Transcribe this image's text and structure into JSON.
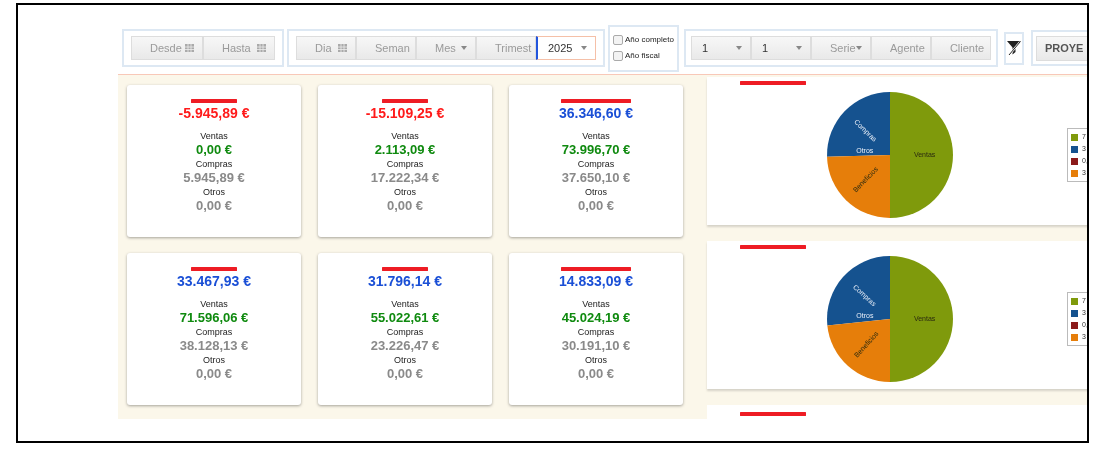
{
  "toolbar": {
    "date_range": [
      {
        "placeholder": "Desde",
        "kind": "date"
      },
      {
        "placeholder": "Hasta",
        "kind": "date"
      }
    ],
    "period": [
      {
        "placeholder": "Dia",
        "kind": "date",
        "focused": false
      },
      {
        "placeholder": "Seman",
        "kind": "select",
        "focused": false
      },
      {
        "placeholder": "Mes",
        "kind": "select",
        "focused": false
      },
      {
        "placeholder": "Trimest",
        "kind": "select",
        "focused": false
      },
      {
        "value": "2025",
        "kind": "select",
        "focused": true
      }
    ],
    "checkboxes": [
      {
        "label": "Año completo",
        "checked": false
      },
      {
        "label": "Año fiscal",
        "checked": false
      }
    ],
    "filters": [
      {
        "value": "1"
      },
      {
        "value": "1"
      },
      {
        "placeholder": "Serie"
      },
      {
        "placeholder": "Agente"
      },
      {
        "placeholder": "Cliente"
      }
    ],
    "project_button": "PROYE"
  },
  "cards": [
    {
      "result": "-5.945,89 €",
      "color": "#ff1a1a",
      "rows": [
        {
          "label": "Ventas",
          "value": "0,00 €",
          "kind": "sales"
        },
        {
          "label": "Compras",
          "value": "5.945,89 €",
          "kind": "other"
        },
        {
          "label": "Otros",
          "value": "0,00 €",
          "kind": "other"
        }
      ]
    },
    {
      "result": "-15.109,25 €",
      "color": "#ff1a1a",
      "rows": [
        {
          "label": "Ventas",
          "value": "2.113,09 €",
          "kind": "sales"
        },
        {
          "label": "Compras",
          "value": "17.222,34 €",
          "kind": "other"
        },
        {
          "label": "Otros",
          "value": "0,00 €",
          "kind": "other"
        }
      ]
    },
    {
      "result": "36.346,60 €",
      "color": "#1a4fd6",
      "rows": [
        {
          "label": "Ventas",
          "value": "73.996,70 €",
          "kind": "sales"
        },
        {
          "label": "Compras",
          "value": "37.650,10 €",
          "kind": "other"
        },
        {
          "label": "Otros",
          "value": "0,00 €",
          "kind": "other"
        }
      ]
    },
    {
      "result": "33.467,93 €",
      "color": "#1a4fd6",
      "rows": [
        {
          "label": "Ventas",
          "value": "71.596,06 €",
          "kind": "sales"
        },
        {
          "label": "Compras",
          "value": "38.128,13 €",
          "kind": "other"
        },
        {
          "label": "Otros",
          "value": "0,00 €",
          "kind": "other"
        }
      ]
    },
    {
      "result": "31.796,14 €",
      "color": "#1a4fd6",
      "rows": [
        {
          "label": "Ventas",
          "value": "55.022,61 €",
          "kind": "sales"
        },
        {
          "label": "Compras",
          "value": "23.226,47 €",
          "kind": "other"
        },
        {
          "label": "Otros",
          "value": "0,00 €",
          "kind": "other"
        }
      ]
    },
    {
      "result": "14.833,09 €",
      "color": "#1a4fd6",
      "rows": [
        {
          "label": "Ventas",
          "value": "45.024,19 €",
          "kind": "sales"
        },
        {
          "label": "Compras",
          "value": "30.191,10 €",
          "kind": "other"
        },
        {
          "label": "Otros",
          "value": "0,00 €",
          "kind": "other"
        }
      ]
    }
  ],
  "charts": [
    {
      "chart_data": {
        "type": "pie",
        "categories": [
          "Ventas",
          "Compras",
          "Otros",
          "Beneficios"
        ],
        "series": [
          {
            "values": [
              50.0,
              25.44,
              0,
              24.56
            ]
          }
        ]
      },
      "legend": [
        {
          "text": "7",
          "color": "#7f9a0c"
        },
        {
          "text": "3",
          "color": "#15528f"
        },
        {
          "text": "0,",
          "color": "#8b1a1a"
        },
        {
          "text": "3",
          "color": "#e67e0a"
        }
      ]
    },
    {
      "chart_data": {
        "type": "pie",
        "categories": [
          "Ventas",
          "Compras",
          "Otros",
          "Beneficios"
        ],
        "series": [
          {
            "values": [
              50.0,
              26.63,
              0,
              23.37
            ]
          }
        ]
      },
      "legend": [
        {
          "text": "7",
          "color": "#7f9a0c"
        },
        {
          "text": "3",
          "color": "#15528f"
        },
        {
          "text": "0,",
          "color": "#8b1a1a"
        },
        {
          "text": "3",
          "color": "#e67e0a"
        }
      ]
    }
  ]
}
